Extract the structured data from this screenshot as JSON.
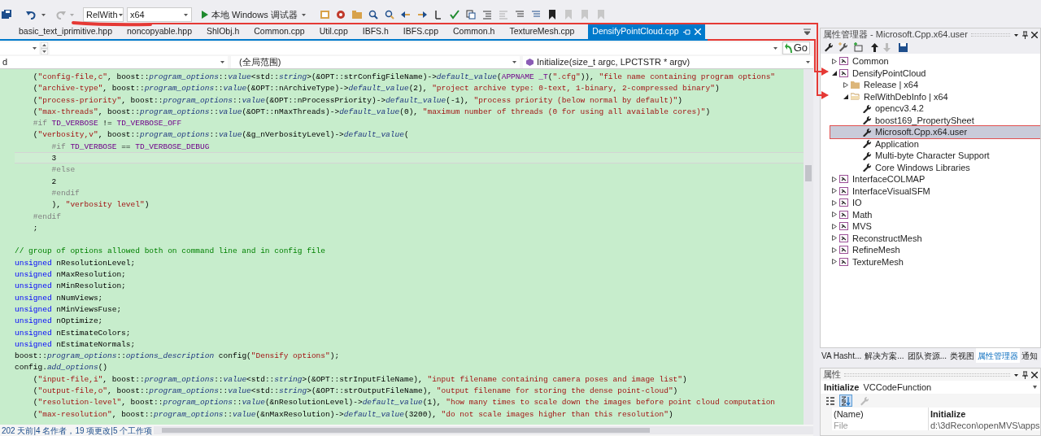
{
  "toolbar": {
    "configuration": "RelWith",
    "platform": "x64",
    "debugger": "本地 Windows 调试器"
  },
  "editor": {
    "tabs": [
      {
        "label": "basic_text_iprimitive.hpp",
        "selected": false
      },
      {
        "label": "noncopyable.hpp",
        "selected": false
      },
      {
        "label": "ShlObj.h",
        "selected": false
      },
      {
        "label": "Common.cpp",
        "selected": false
      },
      {
        "label": "Util.cpp",
        "selected": false
      },
      {
        "label": "IBFS.h",
        "selected": false
      },
      {
        "label": "IBFS.cpp",
        "selected": false
      },
      {
        "label": "Common.h",
        "selected": false
      },
      {
        "label": "TextureMesh.cpp",
        "selected": false
      },
      {
        "label": "DensifyPointCloud.cpp",
        "selected": true
      }
    ],
    "go_button": "Go",
    "nav": {
      "project": "d",
      "scope": "(全局范围)",
      "member": "Initialize(size_t argc, LPCTSTR * argv)"
    },
    "lines": [
      {
        "current": false,
        "tokens": [
          {
            "kind": "plain",
            "text": "    ("
          },
          {
            "kind": "string",
            "text": "\"config-file,c\""
          },
          {
            "kind": "plain",
            "text": ", boost::"
          },
          {
            "kind": "member",
            "text": "program_options"
          },
          {
            "kind": "plain",
            "text": "::"
          },
          {
            "kind": "member",
            "text": "value"
          },
          {
            "kind": "plain",
            "text": "<std::"
          },
          {
            "kind": "member",
            "text": "string"
          },
          {
            "kind": "plain",
            "text": ">(&OPT::strConfigFileName)->"
          },
          {
            "kind": "member",
            "text": "default_value"
          },
          {
            "kind": "plain",
            "text": "("
          },
          {
            "kind": "macro",
            "text": "APPNAME _T"
          },
          {
            "kind": "plain",
            "text": "("
          },
          {
            "kind": "string",
            "text": "\".cfg\""
          },
          {
            "kind": "plain",
            "text": ")), "
          },
          {
            "kind": "string",
            "text": "\"file name containing program options\""
          }
        ]
      },
      {
        "current": false,
        "tokens": [
          {
            "kind": "plain",
            "text": "    ("
          },
          {
            "kind": "string",
            "text": "\"archive-type\""
          },
          {
            "kind": "plain",
            "text": ", boost::"
          },
          {
            "kind": "member",
            "text": "program_options"
          },
          {
            "kind": "plain",
            "text": "::"
          },
          {
            "kind": "member",
            "text": "value"
          },
          {
            "kind": "plain",
            "text": "(&OPT::nArchiveType)->"
          },
          {
            "kind": "member",
            "text": "default_value"
          },
          {
            "kind": "plain",
            "text": "(2), "
          },
          {
            "kind": "string",
            "text": "\"project archive type: 0-text, 1-binary, 2-compressed binary\""
          },
          {
            "kind": "plain",
            "text": ")"
          }
        ]
      },
      {
        "current": false,
        "tokens": [
          {
            "kind": "plain",
            "text": "    ("
          },
          {
            "kind": "string",
            "text": "\"process-priority\""
          },
          {
            "kind": "plain",
            "text": ", boost::"
          },
          {
            "kind": "member",
            "text": "program_options"
          },
          {
            "kind": "plain",
            "text": "::"
          },
          {
            "kind": "member",
            "text": "value"
          },
          {
            "kind": "plain",
            "text": "(&OPT::nProcessPriority)->"
          },
          {
            "kind": "member",
            "text": "default_value"
          },
          {
            "kind": "plain",
            "text": "(-1), "
          },
          {
            "kind": "string",
            "text": "\"process priority (below normal by default)\""
          },
          {
            "kind": "plain",
            "text": ")"
          }
        ]
      },
      {
        "current": false,
        "tokens": [
          {
            "kind": "plain",
            "text": "    ("
          },
          {
            "kind": "string",
            "text": "\"max-threads\""
          },
          {
            "kind": "plain",
            "text": ", boost::"
          },
          {
            "kind": "member",
            "text": "program_options"
          },
          {
            "kind": "plain",
            "text": "::"
          },
          {
            "kind": "member",
            "text": "value"
          },
          {
            "kind": "plain",
            "text": "(&OPT::nMaxThreads)->"
          },
          {
            "kind": "member",
            "text": "default_value"
          },
          {
            "kind": "plain",
            "text": "(0), "
          },
          {
            "kind": "string",
            "text": "\"maximum number of threads (0 for using all available cores)\""
          },
          {
            "kind": "plain",
            "text": ")"
          }
        ]
      },
      {
        "current": false,
        "tokens": [
          {
            "kind": "directive",
            "text": "    #if "
          },
          {
            "kind": "macro",
            "text": "TD_VERBOSE"
          },
          {
            "kind": "plain",
            "text": " != "
          },
          {
            "kind": "macro",
            "text": "TD_VERBOSE_OFF"
          }
        ]
      },
      {
        "current": false,
        "tokens": [
          {
            "kind": "plain",
            "text": "    ("
          },
          {
            "kind": "string",
            "text": "\"verbosity,v\""
          },
          {
            "kind": "plain",
            "text": ", boost::"
          },
          {
            "kind": "member",
            "text": "program_options"
          },
          {
            "kind": "plain",
            "text": "::"
          },
          {
            "kind": "member",
            "text": "value"
          },
          {
            "kind": "plain",
            "text": "(&g_nVerbosityLevel)->"
          },
          {
            "kind": "member",
            "text": "default_value"
          },
          {
            "kind": "plain",
            "text": "("
          }
        ]
      },
      {
        "current": false,
        "tokens": [
          {
            "kind": "directive",
            "text": "        #if "
          },
          {
            "kind": "macro",
            "text": "TD_VERBOSE"
          },
          {
            "kind": "plain",
            "text": " == "
          },
          {
            "kind": "macro",
            "text": "TD_VERBOSE_DEBUG"
          }
        ]
      },
      {
        "current": true,
        "tokens": [
          {
            "kind": "plain",
            "text": "        3"
          }
        ]
      },
      {
        "current": false,
        "tokens": [
          {
            "kind": "directive",
            "text": "        #else"
          }
        ]
      },
      {
        "current": false,
        "tokens": [
          {
            "kind": "plain",
            "text": "        2"
          }
        ]
      },
      {
        "current": false,
        "tokens": [
          {
            "kind": "directive",
            "text": "        #endif"
          }
        ]
      },
      {
        "current": false,
        "tokens": [
          {
            "kind": "plain",
            "text": "        ), "
          },
          {
            "kind": "string",
            "text": "\"verbosity level\""
          },
          {
            "kind": "plain",
            "text": ")"
          }
        ]
      },
      {
        "current": false,
        "tokens": [
          {
            "kind": "directive",
            "text": "    #endif"
          }
        ]
      },
      {
        "current": false,
        "tokens": [
          {
            "kind": "plain",
            "text": "    ;"
          }
        ]
      },
      {
        "current": false
      },
      {
        "current": false,
        "tokens": [
          {
            "kind": "comment",
            "text": "// group of options allowed both on command line and in config file"
          }
        ]
      },
      {
        "current": false,
        "tokens": [
          {
            "kind": "keyword",
            "text": "unsigned"
          },
          {
            "kind": "plain",
            "text": " nResolutionLevel;"
          }
        ]
      },
      {
        "current": false,
        "tokens": [
          {
            "kind": "keyword",
            "text": "unsigned"
          },
          {
            "kind": "plain",
            "text": " nMaxResolution;"
          }
        ]
      },
      {
        "current": false,
        "tokens": [
          {
            "kind": "keyword",
            "text": "unsigned"
          },
          {
            "kind": "plain",
            "text": " nMinResolution;"
          }
        ]
      },
      {
        "current": false,
        "tokens": [
          {
            "kind": "keyword",
            "text": "unsigned"
          },
          {
            "kind": "plain",
            "text": " nNumViews;"
          }
        ]
      },
      {
        "current": false,
        "tokens": [
          {
            "kind": "keyword",
            "text": "unsigned"
          },
          {
            "kind": "plain",
            "text": " nMinViewsFuse;"
          }
        ]
      },
      {
        "current": false,
        "tokens": [
          {
            "kind": "keyword",
            "text": "unsigned"
          },
          {
            "kind": "plain",
            "text": " nOptimize;"
          }
        ]
      },
      {
        "current": false,
        "tokens": [
          {
            "kind": "keyword",
            "text": "unsigned"
          },
          {
            "kind": "plain",
            "text": " nEstimateColors;"
          }
        ]
      },
      {
        "current": false,
        "tokens": [
          {
            "kind": "keyword",
            "text": "unsigned"
          },
          {
            "kind": "plain",
            "text": " nEstimateNormals;"
          }
        ]
      },
      {
        "current": false,
        "tokens": [
          {
            "kind": "plain",
            "text": "boost::"
          },
          {
            "kind": "member",
            "text": "program_options"
          },
          {
            "kind": "plain",
            "text": "::"
          },
          {
            "kind": "member",
            "text": "options_description"
          },
          {
            "kind": "plain",
            "text": " config("
          },
          {
            "kind": "string",
            "text": "\"Densify options\""
          },
          {
            "kind": "plain",
            "text": ");"
          }
        ]
      },
      {
        "current": false,
        "tokens": [
          {
            "kind": "plain",
            "text": "config."
          },
          {
            "kind": "member",
            "text": "add_options"
          },
          {
            "kind": "plain",
            "text": "()"
          }
        ]
      },
      {
        "current": false,
        "tokens": [
          {
            "kind": "plain",
            "text": "    ("
          },
          {
            "kind": "string",
            "text": "\"input-file,i\""
          },
          {
            "kind": "plain",
            "text": ", boost::"
          },
          {
            "kind": "member",
            "text": "program_options"
          },
          {
            "kind": "plain",
            "text": "::"
          },
          {
            "kind": "member",
            "text": "value"
          },
          {
            "kind": "plain",
            "text": "<std::"
          },
          {
            "kind": "member",
            "text": "string"
          },
          {
            "kind": "plain",
            "text": ">(&OPT::strInputFileName), "
          },
          {
            "kind": "string",
            "text": "\"input filename containing camera poses and image list\""
          },
          {
            "kind": "plain",
            "text": ")"
          }
        ]
      },
      {
        "current": false,
        "tokens": [
          {
            "kind": "plain",
            "text": "    ("
          },
          {
            "kind": "string",
            "text": "\"output-file,o\""
          },
          {
            "kind": "plain",
            "text": ", boost::"
          },
          {
            "kind": "member",
            "text": "program_options"
          },
          {
            "kind": "plain",
            "text": "::"
          },
          {
            "kind": "member",
            "text": "value"
          },
          {
            "kind": "plain",
            "text": "<std::"
          },
          {
            "kind": "member",
            "text": "string"
          },
          {
            "kind": "plain",
            "text": ">(&OPT::strOutputFileName), "
          },
          {
            "kind": "string",
            "text": "\"output filename for storing the dense point-cloud\""
          },
          {
            "kind": "plain",
            "text": ")"
          }
        ]
      },
      {
        "current": false,
        "tokens": [
          {
            "kind": "plain",
            "text": "    ("
          },
          {
            "kind": "string",
            "text": "\"resolution-level\""
          },
          {
            "kind": "plain",
            "text": ", boost::"
          },
          {
            "kind": "member",
            "text": "program_options"
          },
          {
            "kind": "plain",
            "text": "::"
          },
          {
            "kind": "member",
            "text": "value"
          },
          {
            "kind": "plain",
            "text": "(&nResolutionLevel)->"
          },
          {
            "kind": "member",
            "text": "default_value"
          },
          {
            "kind": "plain",
            "text": "(1), "
          },
          {
            "kind": "string",
            "text": "\"how many times to scale down the images before point cloud computation"
          }
        ]
      },
      {
        "current": false,
        "tokens": [
          {
            "kind": "plain",
            "text": "    ("
          },
          {
            "kind": "string",
            "text": "\"max-resolution\""
          },
          {
            "kind": "plain",
            "text": ", boost::"
          },
          {
            "kind": "member",
            "text": "program_options"
          },
          {
            "kind": "plain",
            "text": "::"
          },
          {
            "kind": "member",
            "text": "value"
          },
          {
            "kind": "plain",
            "text": "(&nMaxResolution)->"
          },
          {
            "kind": "member",
            "text": "default_value"
          },
          {
            "kind": "plain",
            "text": "(3200), "
          },
          {
            "kind": "string",
            "text": "\"do not scale images higher than this resolution\""
          },
          {
            "kind": "plain",
            "text": ")"
          }
        ]
      }
    ],
    "codelens": "202 天前|4 名作者，19 项更改|5 个工作项"
  },
  "property_manager": {
    "title": "属性管理器 - Microsoft.Cpp.x64.user",
    "tree": [
      {
        "label": "Common",
        "kind": "project",
        "expanded": false,
        "selected": false
      },
      {
        "label": "DensifyPointCloud",
        "kind": "project",
        "expanded": true,
        "selected": false,
        "children": [
          {
            "label": "Release | x64",
            "kind": "config",
            "expanded": false,
            "selected": false
          },
          {
            "label": "RelWithDebInfo | x64",
            "kind": "config",
            "expanded": true,
            "selected": false,
            "children": [
              {
                "label": "opencv3.4.2",
                "kind": "sheet",
                "selected": false
              },
              {
                "label": "boost169_PropertySheet",
                "kind": "sheet",
                "selected": false
              },
              {
                "label": "Microsoft.Cpp.x64.user",
                "kind": "sheet",
                "selected": true
              },
              {
                "label": "Application",
                "kind": "sheet",
                "selected": false
              },
              {
                "label": "Multi-byte Character Support",
                "kind": "sheet",
                "selected": false
              },
              {
                "label": "Core Windows Libraries",
                "kind": "sheet",
                "selected": false
              }
            ]
          }
        ]
      },
      {
        "label": "InterfaceCOLMAP",
        "kind": "project",
        "expanded": false,
        "selected": false
      },
      {
        "label": "InterfaceVisualSFM",
        "kind": "project",
        "expanded": false,
        "selected": false
      },
      {
        "label": "IO",
        "kind": "project",
        "expanded": false,
        "selected": false
      },
      {
        "label": "Math",
        "kind": "project",
        "expanded": false,
        "selected": false
      },
      {
        "label": "MVS",
        "kind": "project",
        "expanded": false,
        "selected": false
      },
      {
        "label": "ReconstructMesh",
        "kind": "project",
        "expanded": false,
        "selected": false
      },
      {
        "label": "RefineMesh",
        "kind": "project",
        "expanded": false,
        "selected": false
      },
      {
        "label": "TextureMesh",
        "kind": "project",
        "expanded": false,
        "selected": false
      }
    ]
  },
  "panel_tabs": [
    {
      "label": "VA Hasht...",
      "selected": false
    },
    {
      "label": "解决方案...",
      "selected": false
    },
    {
      "label": "团队资源...",
      "selected": false
    },
    {
      "label": "类视图",
      "selected": false
    },
    {
      "label": "属性管理器",
      "selected": true
    },
    {
      "label": "通知",
      "selected": false
    }
  ],
  "properties": {
    "title": "属性",
    "object_name": "Initialize",
    "object_type": "VCCodeFunction",
    "view_buttons": [
      {
        "kind": "categorized",
        "selected": false
      },
      {
        "kind": "alphabetical",
        "selected": true
      }
    ],
    "rows": [
      {
        "name": "(Name)",
        "value": "Initialize",
        "readonly": false
      },
      {
        "name": "File",
        "value": "d:\\3dRecon\\openMVS\\apps",
        "readonly": true
      }
    ]
  }
}
